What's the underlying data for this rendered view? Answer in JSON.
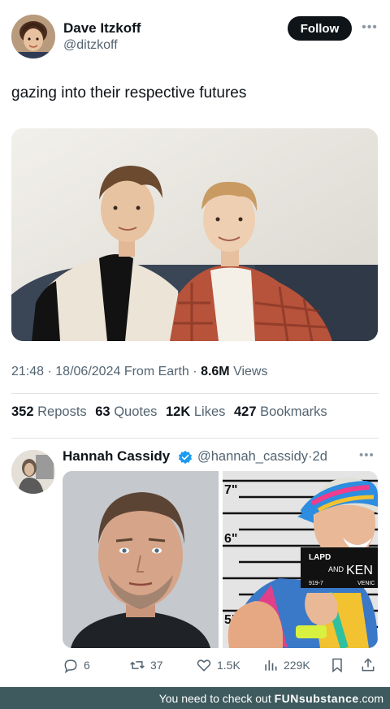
{
  "tweet": {
    "author_name": "Dave Itzkoff",
    "author_handle": "@ditzkoff",
    "follow_label": "Follow",
    "text": "gazing into their respective futures",
    "time": "21:48",
    "date": "18/06/2024",
    "source": "From Earth",
    "views_count": "8.6M",
    "views_label": "Views",
    "stats": [
      {
        "count": "352",
        "label": "Reposts"
      },
      {
        "count": "63",
        "label": "Quotes"
      },
      {
        "count": "12K",
        "label": "Likes"
      },
      {
        "count": "427",
        "label": "Bookmarks"
      }
    ]
  },
  "reply": {
    "author_name": "Hannah Cassidy",
    "author_handle": "@hannah_cassidy",
    "age": "2d",
    "mugshot_sign": {
      "line1": "LAPD",
      "line2a": "AND",
      "line2b": "KEN",
      "line3a": "919-7",
      "line3b": "VENIC"
    },
    "height_marks": [
      "7\"",
      "6\"",
      "5\""
    ],
    "actions": {
      "replies": "6",
      "reposts": "37",
      "likes": "1.5K",
      "views": "229K"
    }
  },
  "footer": {
    "text": "You need to check out",
    "brand": "FUNsubstance",
    "suffix": ".com"
  },
  "icons": {
    "more": "more-dots-icon",
    "verified": "verified-badge-icon",
    "reply": "reply-icon",
    "repost": "repost-icon",
    "like": "heart-icon",
    "views": "analytics-icon",
    "bookmark": "bookmark-icon",
    "share": "share-icon"
  },
  "colors": {
    "verified": "#1d9bf0",
    "follow_bg": "#0f1419",
    "footer_bg": "#3e5a5e",
    "muted_text": "#536471"
  }
}
